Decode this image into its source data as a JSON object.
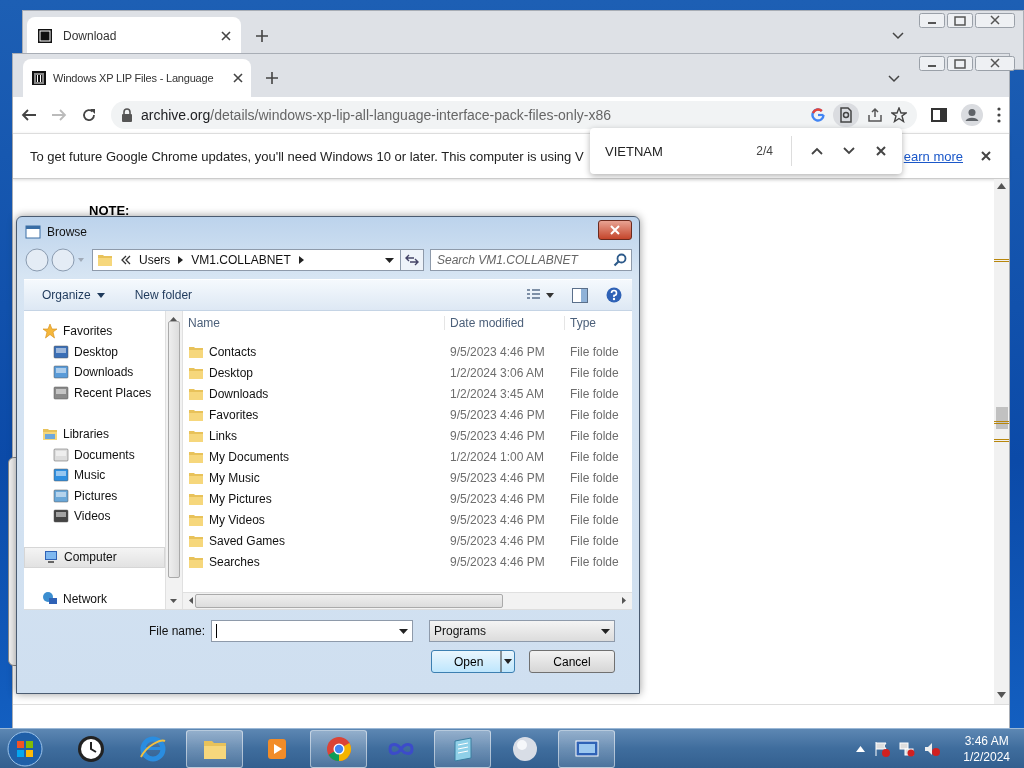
{
  "back_window": {
    "tabs": [
      {
        "title": "Download",
        "selected": true
      }
    ]
  },
  "browser": {
    "tabs": [
      {
        "title": "Windows XP LIP Files - Language",
        "selected": true
      }
    ],
    "address": {
      "host": "archive.org",
      "path": "/details/windows-xp-lip-all-language-interface-pack-files-only-x86"
    },
    "infobar": {
      "message": "To get future Google Chrome updates, you'll need Windows 10 or later. This computer is using V",
      "link": "earn more"
    },
    "page": {
      "heading": "NOTE:"
    }
  },
  "find_bar": {
    "query": "VIETNAM",
    "count": "2/4"
  },
  "dialog": {
    "title": "Browse",
    "breadcrumb": [
      "Users",
      "VM1.COLLABNET"
    ],
    "search": {
      "placeholder": "Search VM1.COLLABNET"
    },
    "toolbar": [
      {
        "label": "Organize",
        "kind": "menu"
      },
      {
        "label": "New folder",
        "kind": "button"
      }
    ],
    "nav": [
      {
        "label": "Favorites",
        "selected": false,
        "children": [
          {
            "label": "Desktop",
            "selected": false
          },
          {
            "label": "Downloads",
            "selected": false
          },
          {
            "label": "Recent Places",
            "selected": false
          }
        ]
      },
      {
        "label": "Libraries",
        "selected": false,
        "children": [
          {
            "label": "Documents",
            "selected": false
          },
          {
            "label": "Music",
            "selected": false
          },
          {
            "label": "Pictures",
            "selected": false
          },
          {
            "label": "Videos",
            "selected": false
          }
        ]
      },
      {
        "label": "Computer",
        "selected": true
      },
      {
        "label": "Network",
        "selected": false
      }
    ],
    "columns": [
      "Name",
      "Date modified",
      "Type"
    ],
    "files": [
      {
        "name": "Contacts",
        "modified": "9/5/2023 4:46 PM",
        "type": "File folde"
      },
      {
        "name": "Desktop",
        "modified": "1/2/2024 3:06 AM",
        "type": "File folde"
      },
      {
        "name": "Downloads",
        "modified": "1/2/2024 3:45 AM",
        "type": "File folde"
      },
      {
        "name": "Favorites",
        "modified": "9/5/2023 4:46 PM",
        "type": "File folde"
      },
      {
        "name": "Links",
        "modified": "9/5/2023 4:46 PM",
        "type": "File folde"
      },
      {
        "name": "My Documents",
        "modified": "1/2/2024 1:00 AM",
        "type": "File folde"
      },
      {
        "name": "My Music",
        "modified": "9/5/2023 4:46 PM",
        "type": "File folde"
      },
      {
        "name": "My Pictures",
        "modified": "9/5/2023 4:46 PM",
        "type": "File folde"
      },
      {
        "name": "My Videos",
        "modified": "9/5/2023 4:46 PM",
        "type": "File folde"
      },
      {
        "name": "Saved Games",
        "modified": "9/5/2023 4:46 PM",
        "type": "File folde"
      },
      {
        "name": "Searches",
        "modified": "9/5/2023 4:46 PM",
        "type": "File folde"
      }
    ],
    "file_name": {
      "label": "File name:"
    },
    "filter": "Programs",
    "buttons": [
      {
        "label": "Open",
        "kind": "split"
      },
      {
        "label": "Cancel",
        "kind": "plain"
      }
    ]
  },
  "taskbar": {
    "apps": [
      {
        "selected": false
      },
      {
        "selected": false
      },
      {
        "selected": true
      },
      {
        "selected": false
      },
      {
        "selected": true
      },
      {
        "selected": false
      },
      {
        "selected": true
      },
      {
        "selected": false
      },
      {
        "selected": true
      }
    ],
    "time": "3:46 AM",
    "date": "1/2/2024"
  }
}
